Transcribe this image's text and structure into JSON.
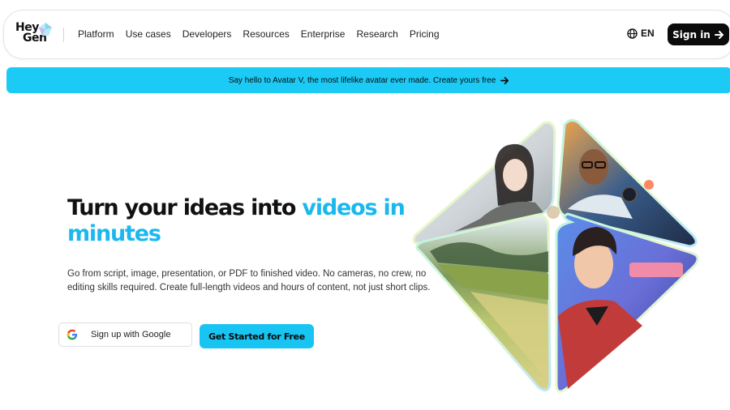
{
  "brand": {
    "logo_line1": "Hey",
    "logo_line2": "Gen"
  },
  "nav": {
    "items": [
      "Platform",
      "Use cases",
      "Developers",
      "Resources",
      "Enterprise",
      "Research",
      "Pricing"
    ]
  },
  "header": {
    "language": "EN",
    "sign_in": "Sign in"
  },
  "announcement": {
    "text": "Say hello to Avatar V, the most lifelike avatar ever made. Create yours free"
  },
  "hero": {
    "title_plain": "Turn your ideas into ",
    "title_accent": "videos in minutes",
    "description": "Go from script, image, presentation, or PDF to finished video. No cameras, no crew, no editing skills required. Create full-length videos and hours of content, not just short clips.",
    "google_button": "Sign up with Google",
    "cta_button": "Get Started for Free"
  },
  "colors": {
    "accent": "#1bb8ee",
    "banner": "#1ccbf5",
    "dark": "#0b0b0b"
  },
  "icons": {
    "logo": "heygen-logo-icon",
    "globe": "globe-icon",
    "arrow": "arrow-right-icon",
    "google": "google-icon"
  }
}
